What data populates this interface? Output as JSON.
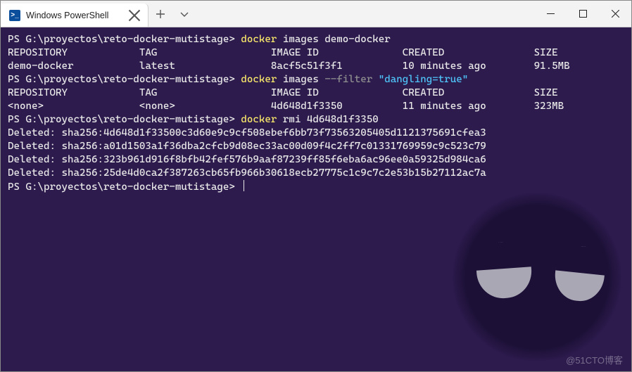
{
  "titlebar": {
    "tab_label": "Windows PowerShell"
  },
  "colors": {
    "terminal_bg": "#2d1b4e",
    "prompt": "#e8e8e8",
    "command": "#f7e66a",
    "flag": "#8f8f8f",
    "string": "#4fc3f7"
  },
  "prompt": "PS G:\\proyectos\\reto-docker-mutistage>",
  "lines": [
    {
      "type": "cmd",
      "prompt": "PS G:\\proyectos\\reto-docker-mutistage>",
      "parts": [
        {
          "cls": "c-yellow",
          "t": "docker"
        },
        {
          "cls": "c-white",
          "t": " images demo-docker"
        }
      ]
    },
    {
      "type": "hdr",
      "cols": [
        "REPOSITORY",
        "TAG",
        "IMAGE ID",
        "CREATED",
        "SIZE"
      ]
    },
    {
      "type": "row",
      "cols": [
        "demo-docker",
        "latest",
        "8acf5c51f3f1",
        "10 minutes ago",
        "91.5MB"
      ]
    },
    {
      "type": "cmd",
      "prompt": "PS G:\\proyectos\\reto-docker-mutistage>",
      "parts": [
        {
          "cls": "c-yellow",
          "t": "docker"
        },
        {
          "cls": "c-white",
          "t": " images "
        },
        {
          "cls": "c-gray",
          "t": "--filter "
        },
        {
          "cls": "c-cyan",
          "t": "\"dangling=true\""
        }
      ]
    },
    {
      "type": "hdr",
      "cols": [
        "REPOSITORY",
        "TAG",
        "IMAGE ID",
        "CREATED",
        "SIZE"
      ]
    },
    {
      "type": "row",
      "cols": [
        "<none>",
        "<none>",
        "4d648d1f3350",
        "11 minutes ago",
        "323MB"
      ]
    },
    {
      "type": "cmd",
      "prompt": "PS G:\\proyectos\\reto-docker-mutistage>",
      "parts": [
        {
          "cls": "c-yellow",
          "t": "docker"
        },
        {
          "cls": "c-white",
          "t": " rmi 4d648d1f3350"
        }
      ]
    },
    {
      "type": "plain",
      "t": "Deleted: sha256:4d648d1f33500c3d60e9c9cf508ebef6bb73f73563205405d1121375691cfea3"
    },
    {
      "type": "plain",
      "t": "Deleted: sha256:a01d1503a1f36dba2cfcb9d08ec33ac00d09f4c2ff7c01331769959c9c523c79"
    },
    {
      "type": "plain",
      "t": "Deleted: sha256:323b961d916f8bfb42fef576b9aaf87239ff85f6eba6ac96ee0a59325d984ca6"
    },
    {
      "type": "plain",
      "t": "Deleted: sha256:25de4d0ca2f387263cb65fb966b30618ecb27775c1c9c7c2e53b15b27112ac7a"
    },
    {
      "type": "cmd_cursor",
      "prompt": "PS G:\\proyectos\\reto-docker-mutistage>"
    }
  ],
  "col_positions": [
    0,
    22,
    44,
    66,
    88
  ],
  "watermark": "@51CTO博客"
}
